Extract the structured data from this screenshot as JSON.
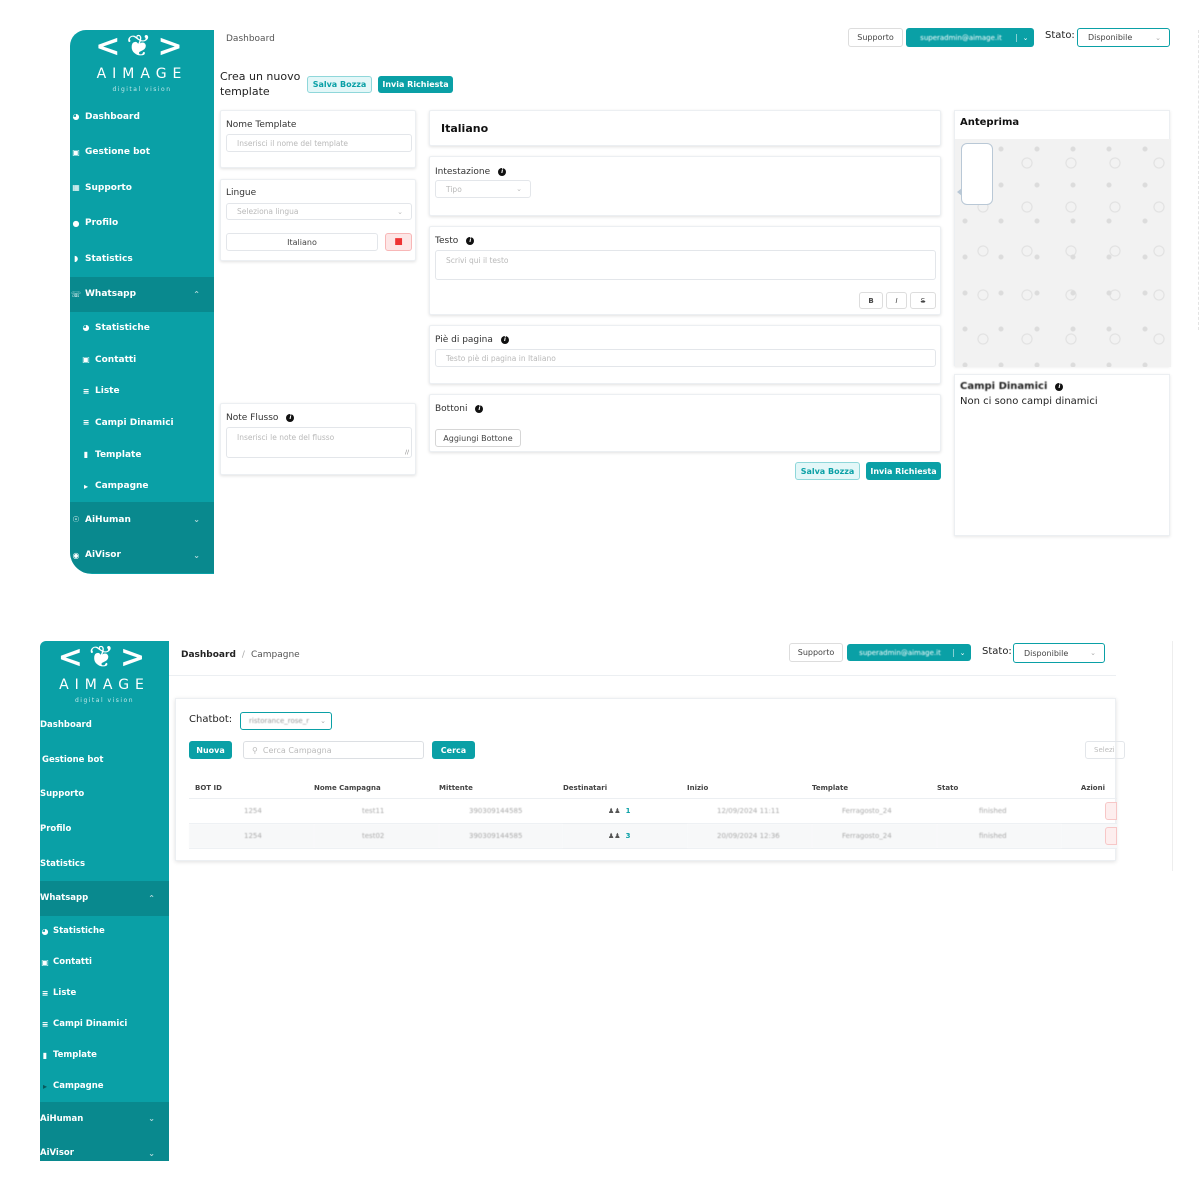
{
  "brand": {
    "name": "AIMAGE",
    "tagline": "digital vision",
    "accent": "#0aa0a6",
    "accent_dark": "#09898e"
  },
  "screen1": {
    "sidebar": {
      "items": [
        {
          "label": "Dashboard",
          "icon": "dashboard-icon"
        },
        {
          "label": "Gestione bot",
          "icon": "robot-icon"
        },
        {
          "label": "Supporto",
          "icon": "calendar-icon"
        },
        {
          "label": "Profilo",
          "icon": "user-icon"
        },
        {
          "label": "Statistics",
          "icon": "chart-pie-icon"
        },
        {
          "label": "Whatsapp",
          "icon": "whatsapp-icon",
          "expanded": true
        },
        {
          "label": "Statistiche",
          "icon": "gauge-icon"
        },
        {
          "label": "Contatti",
          "icon": "contact-icon"
        },
        {
          "label": "Liste",
          "icon": "list-icon"
        },
        {
          "label": "Campi Dinamici",
          "icon": "sliders-icon"
        },
        {
          "label": "Template",
          "icon": "file-icon"
        },
        {
          "label": "Campagne",
          "icon": "megaphone-icon"
        },
        {
          "label": "AiHuman",
          "icon": "ai-human-icon"
        },
        {
          "label": "AiVisor",
          "icon": "eye-icon"
        }
      ]
    },
    "header": {
      "breadcrumb": "Dashboard",
      "support_label": "Supporto",
      "user_email": "superadmin@aimage.it",
      "stato_label": "Stato:",
      "stato_value": "Disponibile"
    },
    "page_title": "Crea un nuovo template",
    "top_actions": {
      "draft": "Salva Bozza",
      "submit": "Invia Richiesta"
    },
    "nome_template": {
      "label": "Nome Template",
      "placeholder": "Inserisci il nome del template"
    },
    "lingue": {
      "label": "Lingue",
      "placeholder": "Seleziona lingua",
      "selected": [
        "Italiano"
      ]
    },
    "note_flusso": {
      "label": "Note Flusso",
      "placeholder": "Inserisci le note del flusso"
    },
    "language_title": "Italiano",
    "intestazione": {
      "label": "Intestazione",
      "placeholder": "Tipo"
    },
    "testo": {
      "label": "Testo",
      "placeholder": "Scrivi qui il testo",
      "format_buttons": [
        "B",
        "I",
        "S"
      ]
    },
    "pie_di_pagina": {
      "label": "Piè di pagina",
      "placeholder": "Testo piè di pagina in Italiano"
    },
    "bottoni": {
      "label": "Bottoni",
      "add_label": "Aggiungi Bottone"
    },
    "bottom_actions": {
      "draft": "Salva Bozza",
      "submit": "Invia Richiesta"
    },
    "anteprima": {
      "title": "Anteprima"
    },
    "campi_dinamici": {
      "title": "Campi Dinamici",
      "empty_message": "Non ci sono campi dinamici"
    }
  },
  "screen2": {
    "sidebar": {
      "items": [
        {
          "label": "Dashboard"
        },
        {
          "label": "Gestione bot"
        },
        {
          "label": "Supporto"
        },
        {
          "label": "Profilo"
        },
        {
          "label": "Statistics"
        },
        {
          "label": "Whatsapp",
          "expanded": true
        },
        {
          "label": "Statistiche",
          "icon": "gauge-icon"
        },
        {
          "label": "Contatti",
          "icon": "contact-icon"
        },
        {
          "label": "Liste",
          "icon": "list-icon"
        },
        {
          "label": "Campi Dinamici",
          "icon": "sliders-icon"
        },
        {
          "label": "Template",
          "icon": "file-icon"
        },
        {
          "label": "Campagne",
          "icon": "megaphone-icon"
        },
        {
          "label": "AiHuman"
        },
        {
          "label": "AiVisor"
        }
      ]
    },
    "header": {
      "breadcrumb_root": "Dashboard",
      "breadcrumb_sep": "/",
      "breadcrumb_current": "Campagne",
      "support_label": "Supporto",
      "user_email": "superadmin@aimage.it",
      "stato_label": "Stato:",
      "stato_value": "Disponibile"
    },
    "filters": {
      "chatbot_label": "Chatbot:",
      "chatbot_value": "ristorance_rose_r",
      "new_label": "Nuova",
      "search_placeholder": "Cerca Campagna",
      "search_button": "Cerca",
      "select_placeholder": "Selezi"
    },
    "table": {
      "columns": [
        "BOT ID",
        "Nome Campagna",
        "Mittente",
        "Destinatari",
        "Inizio",
        "Template",
        "Stato",
        "Azioni"
      ],
      "rows": [
        {
          "bot_id": "1254",
          "nome": "test11",
          "mittente": "390309144585",
          "destinatari": "1",
          "inizio": "12/09/2024 11:11",
          "template": "Ferragosto_24",
          "stato": "finished"
        },
        {
          "bot_id": "1254",
          "nome": "test02",
          "mittente": "390309144585",
          "destinatari": "3",
          "inizio": "20/09/2024 12:36",
          "template": "Ferragosto_24",
          "stato": "finished"
        }
      ]
    }
  }
}
